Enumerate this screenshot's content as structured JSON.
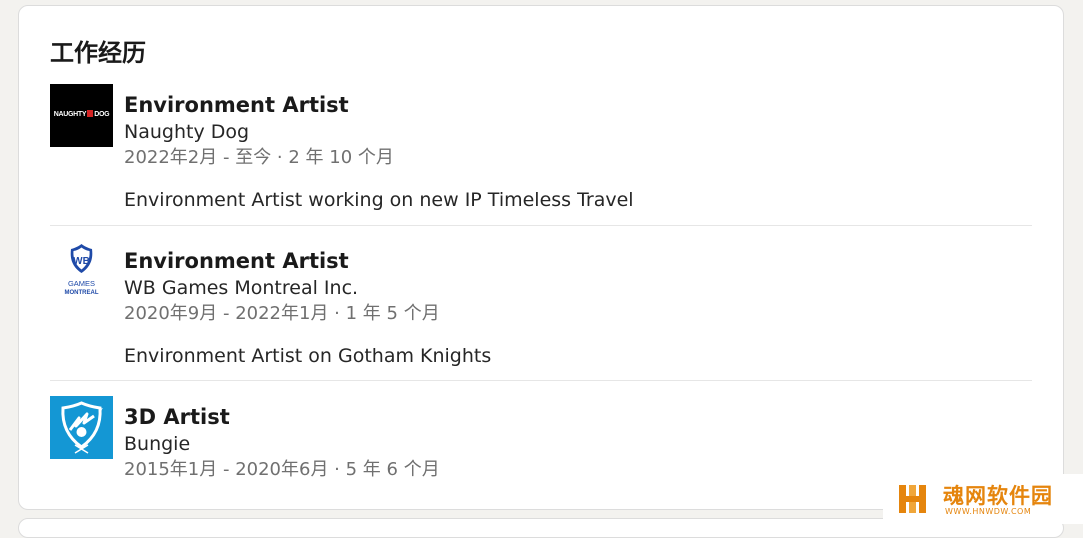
{
  "section": {
    "title": "工作经历"
  },
  "experiences": [
    {
      "logo": {
        "icon": "naughty-dog-logo",
        "text": "NAUGHTY DOG"
      },
      "title": "Environment Artist",
      "company": "Naughty Dog",
      "dates": "2022年2月 - 至今 · 2 年 10 个月",
      "description": "Environment Artist working on new IP Timeless Travel"
    },
    {
      "logo": {
        "icon": "wb-games-montreal-logo",
        "text_top": "GAMES",
        "text_bottom": "MONTREAL"
      },
      "title": "Environment Artist",
      "company": "WB Games Montreal Inc.",
      "dates": "2020年9月 - 2022年1月 · 1 年 5 个月",
      "description": "Environment Artist on Gotham Knights"
    },
    {
      "logo": {
        "icon": "bungie-logo"
      },
      "title": "3D Artist",
      "company": "Bungie",
      "dates": "2015年1月 - 2020年6月 · 5 年 6 个月"
    }
  ],
  "watermark": {
    "title": "魂网软件园",
    "subtitle": "WWW.HNWDW.COM"
  },
  "colors": {
    "bungie_blue": "#1497d4",
    "wb_blue": "#1f4aa8",
    "watermark_orange": "#e5850d"
  }
}
